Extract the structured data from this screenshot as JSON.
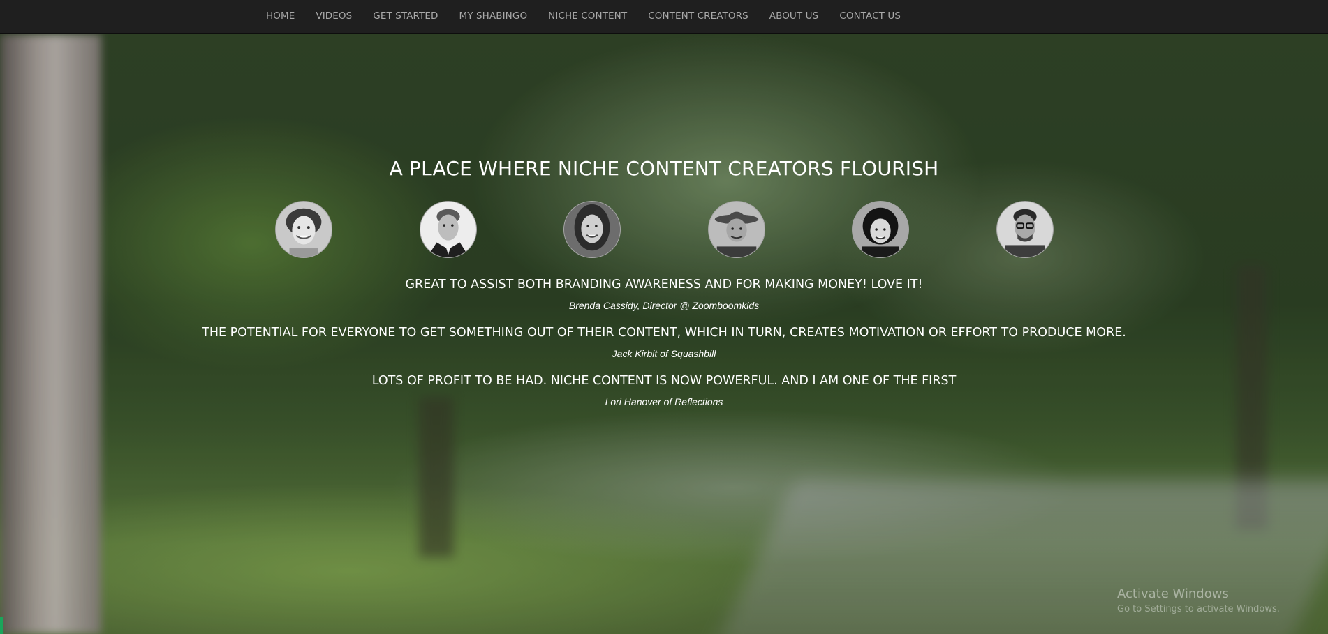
{
  "nav": {
    "items": [
      "HOME",
      "VIDEOS",
      "GET STARTED",
      "MY SHABINGO",
      "NICHE CONTENT",
      "CONTENT CREATORS",
      "ABOUT US",
      "CONTACT US"
    ]
  },
  "hero": {
    "headline": "A PLACE WHERE NICHE CONTENT CREATORS FLOURISH"
  },
  "avatars": [
    "woman-smiling-avatar",
    "man-suit-avatar",
    "woman-long-hair-avatar",
    "man-hat-avatar",
    "woman-dark-hair-avatar",
    "man-glasses-avatar"
  ],
  "testimonials": [
    {
      "quote": "GREAT TO ASSIST BOTH BRANDING AWARENESS AND FOR MAKING MONEY! LOVE IT!",
      "author": "Brenda Cassidy, Director @ Zoomboomkids"
    },
    {
      "quote": "THE POTENTIAL FOR EVERYONE TO GET SOMETHING OUT OF THEIR CONTENT, WHICH IN TURN, CREATES MOTIVATION OR EFFORT TO PRODUCE MORE.",
      "author": "Jack Kirbit of Squashbill"
    },
    {
      "quote": "LOTS OF PROFIT TO BE HAD. NICHE CONTENT IS NOW POWERFUL. AND I AM ONE OF THE FIRST",
      "author": "Lori Hanover of Reflections"
    }
  ],
  "watermark": {
    "title": "Activate Windows",
    "subtitle": "Go to Settings to activate Windows."
  }
}
